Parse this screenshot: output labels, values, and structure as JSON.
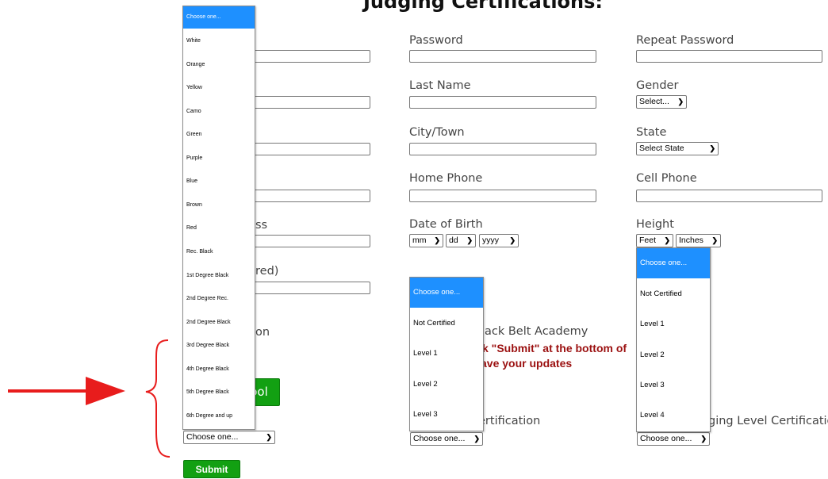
{
  "title": "Judging Certifications:",
  "labels": {
    "password": "Password",
    "repeat_password": "Repeat Password",
    "last_name": "Last Name",
    "gender": "Gender",
    "city": "City/Town",
    "state": "State",
    "home_phone": "Home Phone",
    "cell_phone": "Cell Phone",
    "dob": "Date of Birth",
    "height": "Height",
    "left_partial_email": "ss",
    "left_partial_required": "red)",
    "left_partial_section": "on",
    "academy": "Black Belt Academy",
    "mid_certification": "ertification",
    "right_certification": "ging Level Certification"
  },
  "notice": {
    "line1": "k \"Submit\" at the bottom of",
    "line2": "ave your updates"
  },
  "selects": {
    "gender": "Select...",
    "state": "Select State",
    "dob_mm": "mm",
    "dob_dd": "dd",
    "dob_yyyy": "yyyy",
    "height_feet": "Feet",
    "height_inches": "Inches",
    "belt": "Choose one...",
    "judging_mid": "Choose one...",
    "judging_right": "Choose one..."
  },
  "belt_options": [
    "Choose one...",
    "White",
    "Orange",
    "Yellow",
    "Camo",
    "Green",
    "Purple",
    "Blue",
    "Brown",
    "Red",
    "Rec. Black",
    "1st Degree Black",
    "2nd Degree Rec.",
    "2nd Degree Black",
    "3rd Degree Black",
    "4th Degree Black",
    "5th Degree Black",
    "6th Degree and up"
  ],
  "mid_options": [
    "Choose one...",
    "Not Certified",
    "Level 1",
    "Level 2",
    "Level 3"
  ],
  "right_options": [
    "Choose one...",
    "Not Certified",
    "Level 1",
    "Level 2",
    "Level 3",
    "Level 4"
  ],
  "buttons": {
    "school": "ool",
    "submit": "Submit"
  },
  "colors": {
    "highlight": "#1e90ff",
    "button_green": "#12a012",
    "annotation_red": "#e81c1c",
    "notice_red": "#9b1010"
  }
}
